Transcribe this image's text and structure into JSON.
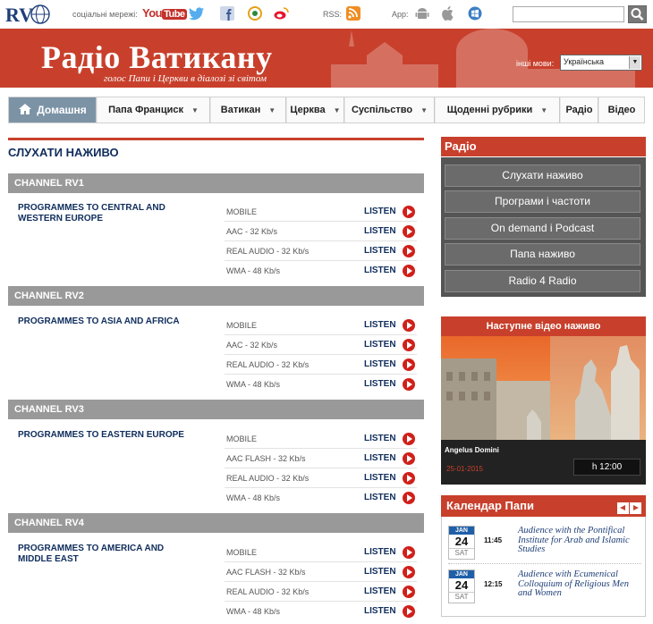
{
  "topbar": {
    "social_label": "соціальні мережі:",
    "rss_label": "RSS:",
    "app_label": "App:",
    "search_placeholder": ""
  },
  "header": {
    "title": "Радіо Ватикану",
    "subtitle": "голос Папи і Церкви в діалозі зі світом",
    "lang_label": "інші мови:",
    "lang_selected": "Українська"
  },
  "nav": {
    "items": [
      {
        "label": "Домашня",
        "dropdown": false
      },
      {
        "label": "Папа Франциск",
        "dropdown": true
      },
      {
        "label": "Ватикан",
        "dropdown": true
      },
      {
        "label": "Церква",
        "dropdown": true
      },
      {
        "label": "Суспільство",
        "dropdown": true
      },
      {
        "label": "Щоденні рубрики",
        "dropdown": true
      },
      {
        "label": "Радіо",
        "dropdown": false
      },
      {
        "label": "Відео",
        "dropdown": false
      }
    ]
  },
  "main": {
    "heading": "СЛУХАТИ НАЖИВО",
    "listen_label": "LISTEN",
    "channels": [
      {
        "name": "CHANNEL RV1",
        "programme": "PROGRAMMES TO CENTRAL AND WESTERN EUROPE",
        "streams": [
          "MOBILE",
          "AAC - 32 Kb/s",
          "REAL AUDIO - 32 Kb/s",
          "WMA - 48 Kb/s"
        ]
      },
      {
        "name": "CHANNEL RV2",
        "programme": "PROGRAMMES TO ASIA AND AFRICA",
        "streams": [
          "MOBILE",
          "AAC - 32 Kb/s",
          "REAL AUDIO - 32 Kb/s",
          "WMA - 48 Kb/s"
        ]
      },
      {
        "name": "CHANNEL RV3",
        "programme": "PROGRAMMES TO EASTERN EUROPE",
        "streams": [
          "MOBILE",
          "AAC FLASH - 32 Kb/s",
          "REAL AUDIO - 32 Kb/s",
          "WMA - 48 Kb/s"
        ]
      },
      {
        "name": "CHANNEL RV4",
        "programme": "PROGRAMMES TO AMERICA AND MIDDLE EAST",
        "streams": [
          "MOBILE",
          "AAC FLASH - 32 Kb/s",
          "REAL AUDIO - 32 Kb/s",
          "WMA - 48 Kb/s"
        ]
      }
    ]
  },
  "sidebar": {
    "radio_title": "Радіо",
    "radio_links": [
      "Слухати наживо",
      "Програми і частоти",
      "On demand i Podcast",
      "Папа наживо",
      "Radio 4 Radio"
    ],
    "video_title": "Наступне відео наживо",
    "video_caption": "Angelus Domini",
    "video_date": "25-01-2015",
    "video_time": "h 12:00",
    "calendar_title": "Календар Папи",
    "calendar": [
      {
        "month": "JAN",
        "day": "24",
        "dow": "SAT",
        "time": "11:45",
        "text": "Audience with the Pontifical Institute for Arab and Islamic Studies"
      },
      {
        "month": "JAN",
        "day": "24",
        "dow": "SAT",
        "time": "12:15",
        "text": "Audience with Ecumenical Colloquium of Religious Men and Women"
      }
    ]
  },
  "colors": {
    "brand_red": "#c8402c",
    "navy": "#0f2d5c",
    "channel_grey": "#999999",
    "play_red": "#d0201a"
  }
}
